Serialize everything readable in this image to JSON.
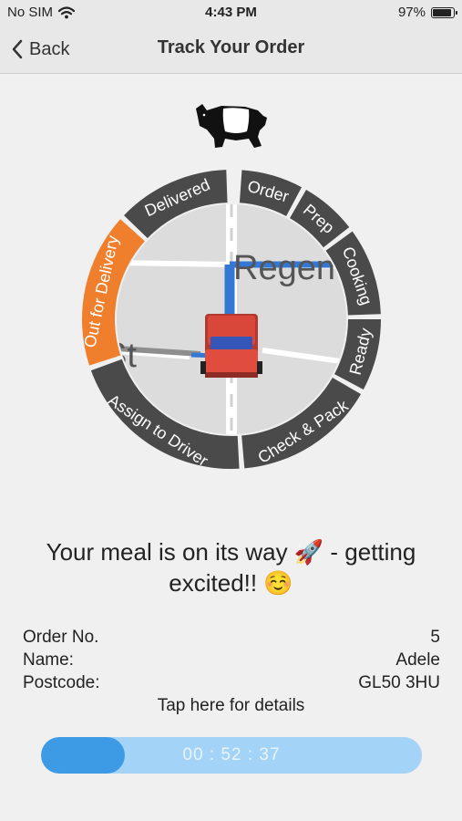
{
  "status_bar": {
    "carrier": "No SIM",
    "time": "4:43 PM",
    "battery": "97%",
    "battery_level": 0.97
  },
  "nav": {
    "back_label": "Back",
    "title": "Track Your Order"
  },
  "tracker": {
    "steps": [
      "Order",
      "Prep",
      "Cooking",
      "Ready",
      "Check & Pack",
      "Assign to Driver",
      "Out for Delivery",
      "Delivered"
    ],
    "active_step": "Out for Delivery",
    "colors": {
      "inactive": "#4a4a4a",
      "active": "#f07f2d",
      "label": "#ffffff"
    },
    "map_labels": {
      "street_1": "Regen",
      "street_2": "St"
    }
  },
  "message": "Your meal is on its way 🚀 - getting excited!! ☺️",
  "order": {
    "number_label": "Order No.",
    "number": "5",
    "name_label": "Name:",
    "name": "Adele",
    "postcode_label": "Postcode:",
    "postcode": "GL50 3HU"
  },
  "details_link": "Tap here for details",
  "timer": {
    "value": "00 : 52 : 37",
    "progress": 0.22,
    "colors": {
      "track": "#a3d3f6",
      "fill": "#3d9be6"
    }
  }
}
